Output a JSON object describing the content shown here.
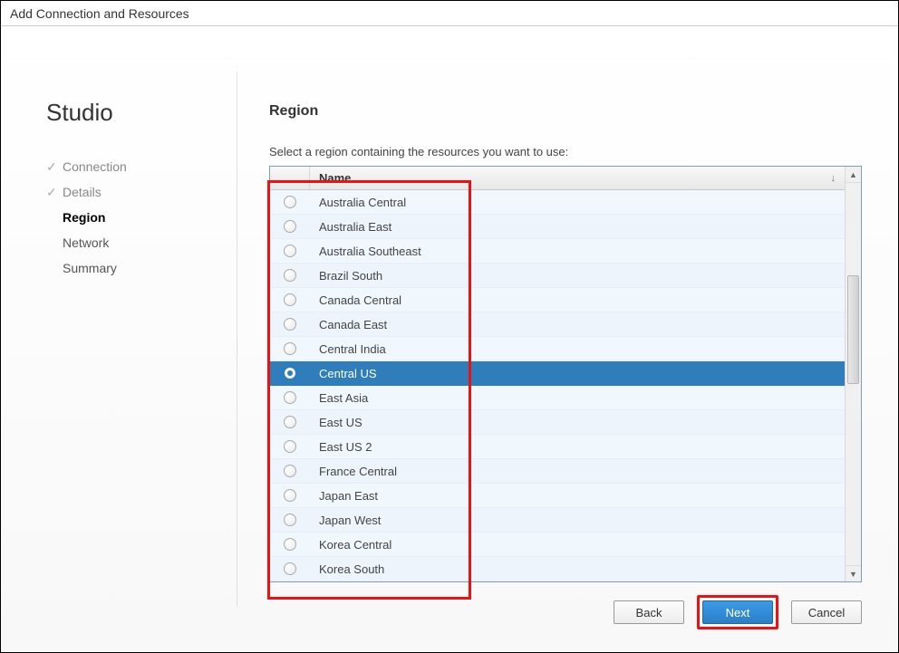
{
  "window": {
    "title": "Add Connection and Resources"
  },
  "sidebar": {
    "app_name": "Studio",
    "steps": [
      {
        "label": "Connection",
        "state": "completed"
      },
      {
        "label": "Details",
        "state": "completed"
      },
      {
        "label": "Region",
        "state": "current"
      },
      {
        "label": "Network",
        "state": "pending"
      },
      {
        "label": "Summary",
        "state": "pending"
      }
    ]
  },
  "main": {
    "heading": "Region",
    "instruction": "Select a region containing the resources you want to use:",
    "column_header": "Name",
    "regions": [
      {
        "name": "Australia Central",
        "selected": false
      },
      {
        "name": "Australia East",
        "selected": false
      },
      {
        "name": "Australia Southeast",
        "selected": false
      },
      {
        "name": "Brazil South",
        "selected": false
      },
      {
        "name": "Canada Central",
        "selected": false
      },
      {
        "name": "Canada East",
        "selected": false
      },
      {
        "name": "Central India",
        "selected": false
      },
      {
        "name": "Central US",
        "selected": true
      },
      {
        "name": "East Asia",
        "selected": false
      },
      {
        "name": "East US",
        "selected": false
      },
      {
        "name": "East US 2",
        "selected": false
      },
      {
        "name": "France Central",
        "selected": false
      },
      {
        "name": "Japan East",
        "selected": false
      },
      {
        "name": "Japan West",
        "selected": false
      },
      {
        "name": "Korea Central",
        "selected": false
      },
      {
        "name": "Korea South",
        "selected": false
      }
    ]
  },
  "buttons": {
    "back": "Back",
    "next": "Next",
    "cancel": "Cancel"
  }
}
